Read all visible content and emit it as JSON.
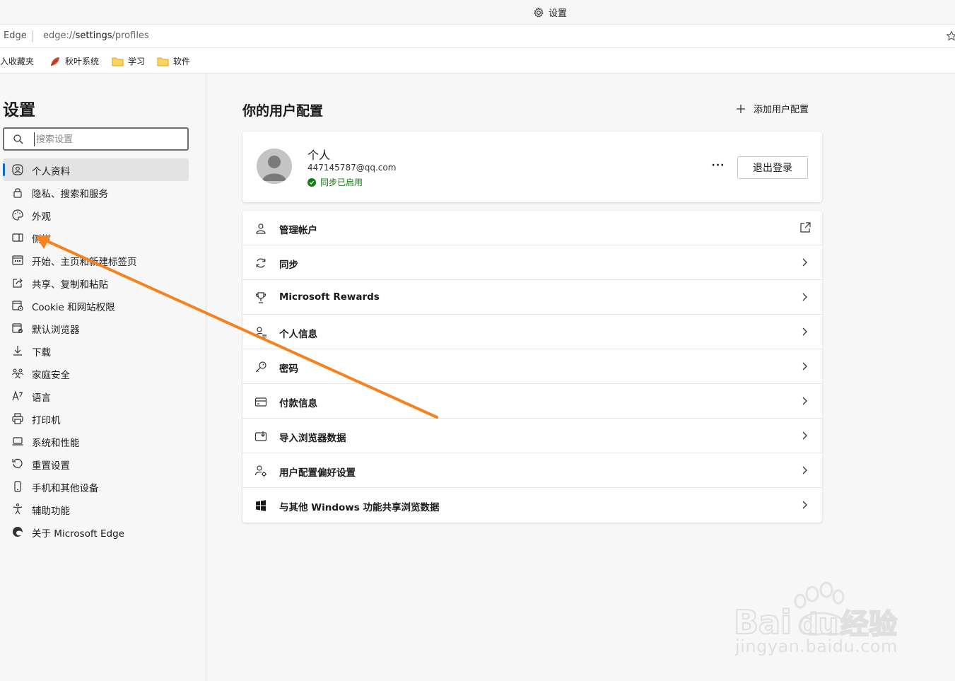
{
  "titlebar": {
    "title": "设置",
    "icon": "gear-icon"
  },
  "address": {
    "site": "Edge",
    "url_prefix": "edge://",
    "url_strong": "settings",
    "url_suffix": "/profiles"
  },
  "favorites": [
    {
      "label": "入收藏夹",
      "icon": "none"
    },
    {
      "label": "秋叶系统",
      "icon": "leaf-icon"
    },
    {
      "label": "学习",
      "icon": "folder-icon"
    },
    {
      "label": "软件",
      "icon": "folder-icon"
    }
  ],
  "sidebar": {
    "title": "设置",
    "search_placeholder": "搜索设置",
    "items": [
      {
        "label": "个人资料",
        "icon": "profile-icon",
        "active": true
      },
      {
        "label": "隐私、搜索和服务",
        "icon": "lock-icon"
      },
      {
        "label": "外观",
        "icon": "palette-icon"
      },
      {
        "label": "侧栏",
        "icon": "sidebar-icon"
      },
      {
        "label": "开始、主页和新建标签页",
        "icon": "home-tab-icon"
      },
      {
        "label": "共享、复制和粘贴",
        "icon": "share-icon"
      },
      {
        "label": "Cookie 和网站权限",
        "icon": "cookie-icon"
      },
      {
        "label": "默认浏览器",
        "icon": "browser-icon"
      },
      {
        "label": "下载",
        "icon": "download-icon"
      },
      {
        "label": "家庭安全",
        "icon": "family-icon"
      },
      {
        "label": "语言",
        "icon": "language-icon"
      },
      {
        "label": "打印机",
        "icon": "printer-icon"
      },
      {
        "label": "系统和性能",
        "icon": "laptop-icon"
      },
      {
        "label": "重置设置",
        "icon": "reset-icon"
      },
      {
        "label": "手机和其他设备",
        "icon": "phone-icon"
      },
      {
        "label": "辅助功能",
        "icon": "accessibility-icon"
      },
      {
        "label": "关于 Microsoft Edge",
        "icon": "edge-logo-icon"
      }
    ]
  },
  "main": {
    "title": "你的用户配置",
    "add_profile": "添加用户配置",
    "profile": {
      "name": "个人",
      "email": "447145787@qq.com",
      "sync_status": "同步已启用",
      "more": "···",
      "signout": "退出登录"
    },
    "rows": [
      {
        "label": "管理帐户",
        "icon": "person-icon",
        "trailing": "external-link-icon"
      },
      {
        "label": "同步",
        "icon": "sync-icon",
        "trailing": "chevron-right-icon"
      },
      {
        "label": "Microsoft Rewards",
        "icon": "trophy-icon",
        "trailing": "chevron-right-icon"
      },
      {
        "label": "个人信息",
        "icon": "person-info-icon",
        "trailing": "chevron-right-icon"
      },
      {
        "label": "密码",
        "icon": "key-icon",
        "trailing": "chevron-right-icon"
      },
      {
        "label": "付款信息",
        "icon": "card-icon",
        "trailing": "chevron-right-icon"
      },
      {
        "label": "导入浏览器数据",
        "icon": "import-icon",
        "trailing": "chevron-right-icon"
      },
      {
        "label": "用户配置偏好设置",
        "icon": "profile-prefs-icon",
        "trailing": "chevron-right-icon"
      },
      {
        "label": "与其他 Windows 功能共享浏览数据",
        "icon": "windows-icon",
        "trailing": "chevron-right-icon"
      }
    ]
  },
  "annotation": {
    "color": "#f58220"
  },
  "watermark": {
    "text": "jingyan.baidu.com",
    "logo": "Baidu经验"
  }
}
